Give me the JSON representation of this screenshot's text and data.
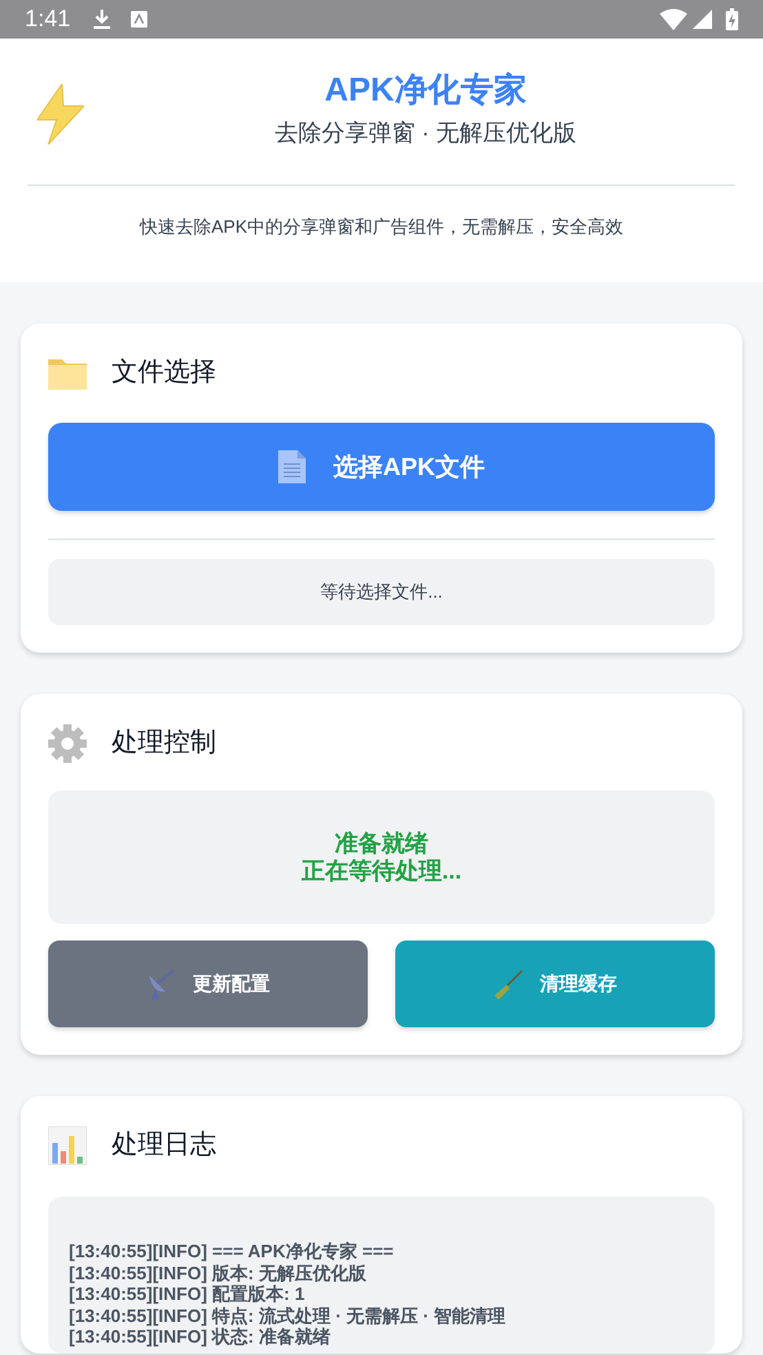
{
  "status_bar": {
    "time": "1:41"
  },
  "header": {
    "title": "APK净化专家",
    "subtitle": "去除分享弹窗 · 无解压优化版",
    "tagline": "快速去除APK中的分享弹窗和广告组件，无需解压，安全高效"
  },
  "file_card": {
    "title": "文件选择",
    "button": "选择APK文件",
    "file_status": "等待选择文件..."
  },
  "control_card": {
    "title": "处理控制",
    "status_lines": [
      "准备就绪",
      "正在等待处理..."
    ],
    "buttons": [
      {
        "label": "更新配置",
        "kind": "update"
      },
      {
        "label": "清理缓存",
        "kind": "clean"
      }
    ]
  },
  "log_card": {
    "title": "处理日志",
    "lines": [
      "[13:40:55][INFO] === APK净化专家 ===",
      "[13:40:55][INFO] 版本: 无解压优化版",
      "[13:40:55][INFO] 配置版本: 1",
      "[13:40:55][INFO] 特点: 流式处理 · 无需解压 · 智能清理",
      "[13:40:55][INFO] 状态: 准备就绪"
    ]
  }
}
